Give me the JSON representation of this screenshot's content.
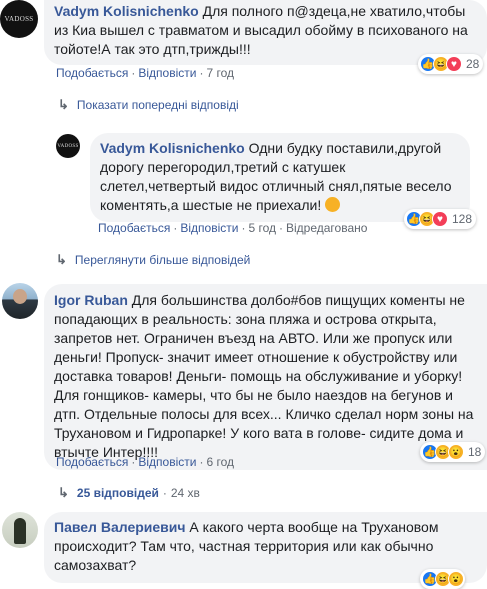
{
  "comments": [
    {
      "author": "Vadym Kolisnichenko",
      "avatar_text": "VADOSS",
      "text": "Для полного п@здеца,не хватило,чтобы из Киа вышел с травматом и высадил обойму в психованого на тойоте!А так это дтп,трижды!!!",
      "like": "Подобається",
      "reply": "Відповісти",
      "time": "7 год",
      "reactions": "28",
      "reaction_icons": [
        "like-icon",
        "haha-icon",
        "love-icon"
      ]
    },
    {
      "author": "Vadym Kolisnichenko",
      "avatar_text": "VADOSS",
      "text": "Одни будку поставили,другой дорогу перегородил,третий с катушек слетел,четвертый видос отличный снял,пятые весело коментять,а шестые не приехали!",
      "like": "Подобається",
      "reply": "Відповісти",
      "time": "5 год",
      "edited": "Відредаговано",
      "reactions": "128",
      "reaction_icons": [
        "like-icon",
        "haha-icon",
        "love-icon"
      ]
    },
    {
      "author": "Igor Ruban",
      "text": "Для большинства долбо#бов пищущих коменты не попадающих в реальность: зона пляжа и острова открыта, запретов нет. Ограничен въезд на АВТО. Или же пропуск или деньги! Пропуск- значит имеет отношение к обустройству или доставка товаров! Деньги- помощь на обслуживание и уборку! Для гонщиков- камеры, что бы не было наездов на бегунов и дтп. Отдельные полосы для всех... Кличко сделал норм зоны на Трухановом и Гидропарке! У кого вата в голове- сидите дома и втычте Интер!!!!",
      "like": "Подобається",
      "reply": "Відповісти",
      "time": "6 год",
      "reactions": "18",
      "reaction_icons": [
        "like-icon",
        "haha-icon",
        "wow-icon"
      ]
    },
    {
      "author": "Павел Валериевич",
      "text": "А какого черта вообще на Трухановом происходит? Там что, частная территория или как обычно самозахват?",
      "reaction_icons": [
        "like-icon",
        "haha-icon",
        "wow-icon"
      ]
    }
  ],
  "show_previous": "Показати попередні відповіді",
  "see_more": "Переглянути більше відповідей",
  "replies_count": "25 відповідей",
  "replies_time": "24 хв"
}
